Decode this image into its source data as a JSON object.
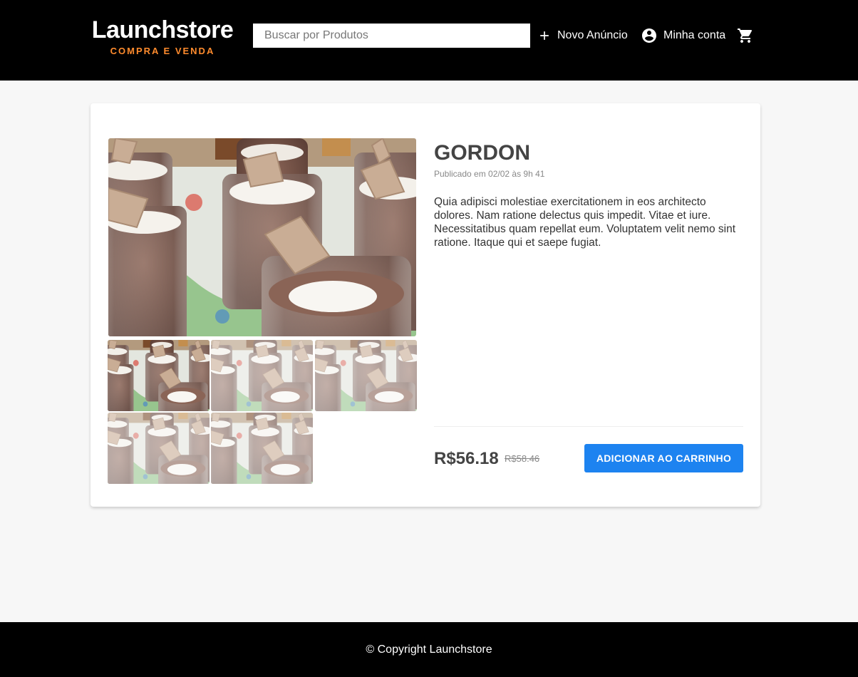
{
  "header": {
    "logo_title": "Launchstore",
    "logo_subtitle": "COMPRA E VENDA",
    "search_placeholder": "Buscar por Produtos",
    "new_ad_label": "Novo Anúncio",
    "account_label": "Minha conta",
    "icons": {
      "new_ad": "plus-icon",
      "account": "account-circle-icon",
      "cart": "shopping-cart-icon"
    }
  },
  "product": {
    "title": "GORDON",
    "published": "Publicado em 02/02 às 9h 41",
    "description": "Quia adipisci molestiae exercitationem in eos architecto dolores. Nam ratione delectus quis impedit. Vitae et iure. Necessitatibus quam repellat eum. Voluptatem velit nemo sint ratione. Itaque qui et saepe fugiat.",
    "price": "R$56.18",
    "old_price": "R$58.46",
    "add_to_cart_label": "ADICIONAR AO CARRINHO",
    "gallery_count": 5
  },
  "footer": {
    "copyright": "© Copyright Launchstore"
  },
  "colors": {
    "header_bg": "#000000",
    "accent": "#ff8b2d",
    "button": "#1d83f0",
    "page_bg": "#f7f7f7"
  }
}
